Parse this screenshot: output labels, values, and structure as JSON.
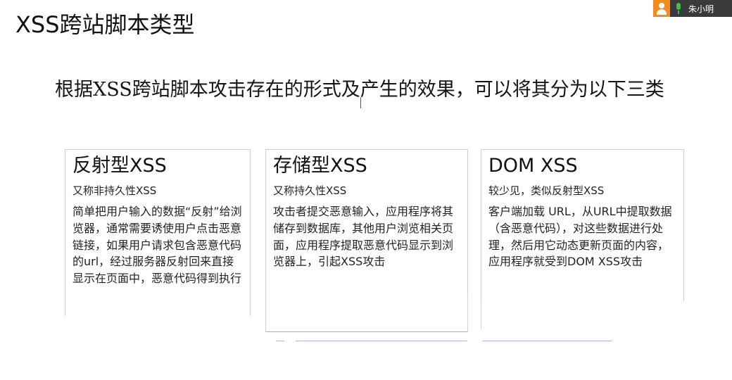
{
  "slide": {
    "title": "XSS跨站脚本类型",
    "intro": "根据XSS跨站脚本攻击存在的形式及产生的效果，可以将其分为以下三类"
  },
  "cards": [
    {
      "title": "反射型XSS",
      "subtitle": "又称非持久性XSS",
      "body": "简单把用户输入的数据“反射”给浏览器，通常需要诱使用户点击恶意链接，如果用户请求包含恶意代码的url，经过服务器反射回来直接显示在页面中，恶意代码得到执行"
    },
    {
      "title": "存储型XSS",
      "subtitle": "又称持久性XSS",
      "body": "攻击者提交恶意输入，应用程序将其储存到数据库，其他用户浏览相关页面，应用程序提取恶意代码显示到浏览器上，引起XSS攻击"
    },
    {
      "title": "DOM XSS",
      "subtitle": "较少见，类似反射型XSS",
      "body": "客户端加载 URL，从URL中提取数据（含恶意代码），对这些数据进行处理，然后用它动态更新页面的内容，应用程序就受到DOM XSS攻击"
    }
  ],
  "meeting": {
    "user_name": "朱小明",
    "icons": [
      "user-avatar-icon",
      "microphone-icon"
    ],
    "colors": {
      "badge_bg": "#3a3a3a",
      "avatar": "#f58b1f",
      "mic": "#3fbf4a"
    }
  }
}
